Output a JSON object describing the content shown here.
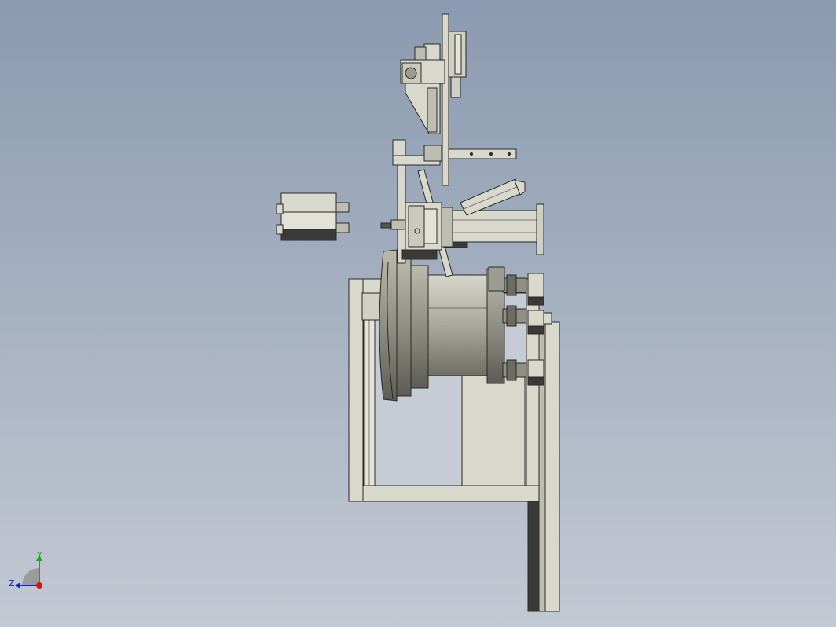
{
  "viewport": {
    "background_top": "#8a9ab0",
    "background_bottom": "#c3c9d3"
  },
  "model": {
    "part_fill": "#d8d8cc",
    "part_stroke": "#2a2a26",
    "dark_fill": "#3a3a36",
    "drum_shade": "#9c9c92"
  },
  "triad": {
    "x_label": "",
    "y_label": "Y",
    "z_label": "Z",
    "x_color": "#e01010",
    "y_color": "#10b010",
    "z_color": "#1020e0"
  }
}
